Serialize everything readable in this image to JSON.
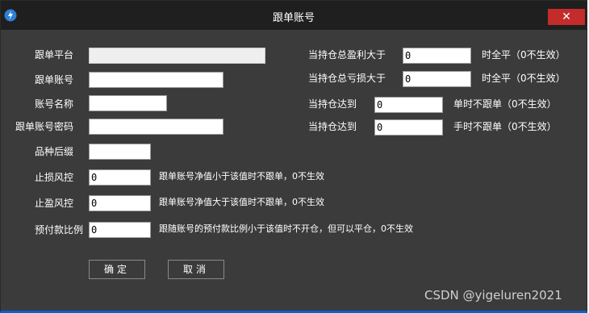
{
  "window": {
    "title": "跟单账号",
    "close_symbol": "✕"
  },
  "left": {
    "platform_label": "跟单平台",
    "account_label": "跟单账号",
    "account_name_label": "账号名称",
    "password_label": "跟单账号密码",
    "suffix_label": "品种后缀",
    "stoploss_label": "止损风控",
    "stoploss_value": "0",
    "stoploss_desc": "跟单账号净值小于该值时不跟单，0不生效",
    "takeprofit_label": "止盈风控",
    "takeprofit_value": "0",
    "takeprofit_desc": "跟单账号净值大于该值时不跟单，0不生效",
    "prepay_label": "预付款比例",
    "prepay_value": "0",
    "prepay_desc": "跟随账号的预付款比例小于该值时不开仓，但可以平仓，0不生效"
  },
  "right": {
    "profit_label": "当持仓总盈利大于",
    "profit_value": "0",
    "profit_suffix": "时全平（0不生效）",
    "loss_label": "当持仓总亏损大于",
    "loss_value": "0",
    "loss_suffix": "时全平（0不生效）",
    "single_label": "当持仓达到",
    "single_value": "0",
    "single_suffix": "单时不跟单（0不生效）",
    "lots_label": "当持仓达到",
    "lots_value": "0",
    "lots_suffix": "手时不跟单（0不生效）"
  },
  "buttons": {
    "ok": "确定",
    "cancel": "取消"
  },
  "watermark": "CSDN @yigeluren2021"
}
